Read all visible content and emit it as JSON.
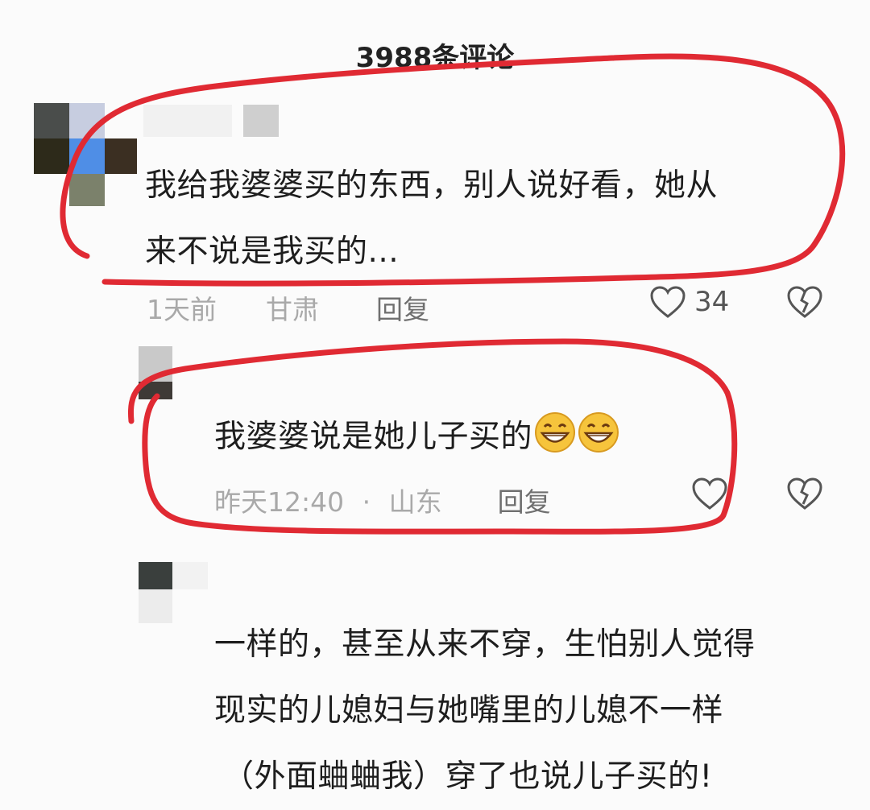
{
  "header": {
    "comment_count_title": "3988条评论"
  },
  "comments": [
    {
      "text_line1": "我给我婆婆买的东西，别人说好看，她从",
      "text_line2": "来不说是我买的...",
      "time": "1天前",
      "location": "甘肃",
      "reply_label": "回复",
      "like_count": "34"
    },
    {
      "text": "我婆婆说是她儿子买的",
      "time": "昨天12:40",
      "separator": "·",
      "location": "山东",
      "reply_label": "回复",
      "like_count": ""
    },
    {
      "text_line1": "一样的，甚至从来不穿，生怕别人觉得",
      "text_line2": "现实的儿媳妇与她嘴里的儿媳不一样",
      "text_line3": "（外面蛐蛐我）穿了也说儿子买的!"
    }
  ],
  "colors": {
    "annotation_red": "#e02a33",
    "meta_gray": "#a9a9a9",
    "text_dark": "#1e1e1e"
  }
}
